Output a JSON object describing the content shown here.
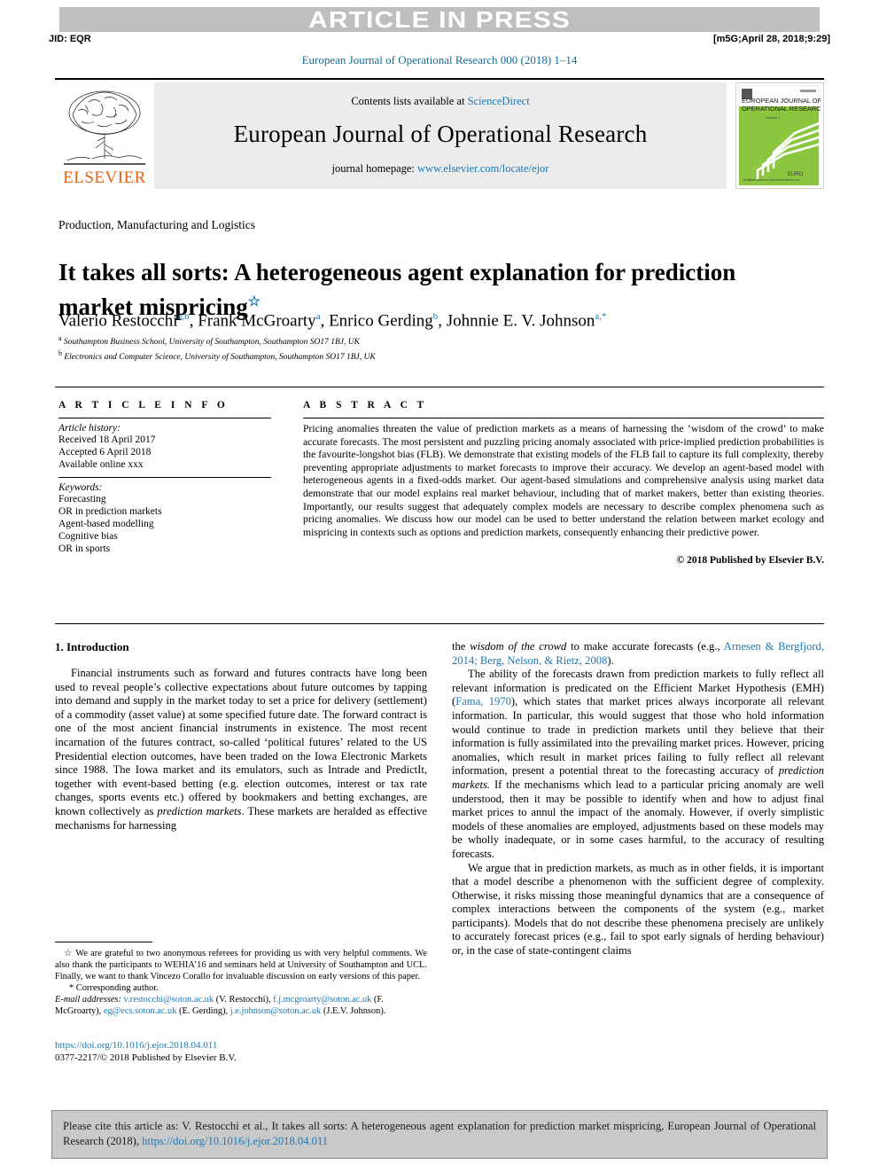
{
  "banner": {
    "text": "ARTICLE IN PRESS"
  },
  "runhead": {
    "left": "JID: EQR",
    "right": "[m5G;April 28, 2018;9:29]"
  },
  "journal_ref": "European Journal of Operational Research 000 (2018) 1–14",
  "masthead": {
    "contents_prefix": "Contents lists available at ",
    "contents_link": "ScienceDirect",
    "journal_title": "European Journal of Operational Research",
    "homepage_prefix": "journal homepage: ",
    "homepage_link": "www.elsevier.com/locate/ejor",
    "publisher": "ELSEVIER",
    "cover": {
      "line1": "EUROPEAN JOURNAL OF",
      "line2": "OPERATIONAL RESEARCH",
      "volume": "Volume 1",
      "footer": "EURO"
    }
  },
  "article": {
    "section_label": "Production, Manufacturing and Logistics",
    "title": "It takes all sorts: A heterogeneous agent explanation for prediction market mispricing",
    "title_mark": "☆",
    "authors_html": "Valerio Restocchi<sup>a,b</sup>, Frank McGroarty<sup>a</sup>, Enrico Gerding<sup>b</sup>, Johnnie E. V. Johnson<sup>a,*</sup>",
    "affiliations": [
      {
        "mark": "a",
        "text": "Southampton Business School, University of Southampton, Southampton SO17 1BJ, UK"
      },
      {
        "mark": "b",
        "text": "Electronics and Computer Science, University of Southampton, Southampton SO17 1BJ, UK"
      }
    ]
  },
  "info": {
    "heading": "A R T I C L E  I N F O",
    "history_label": "Article history:",
    "history": [
      "Received 18 April 2017",
      "Accepted 6 April 2018",
      "Available online xxx"
    ],
    "keywords_label": "Keywords:",
    "keywords": [
      "Forecasting",
      "OR in prediction markets",
      "Agent-based modelling",
      "Cognitive bias",
      "OR in sports"
    ]
  },
  "abstract": {
    "heading": "A B S T R A C T",
    "text": "Pricing anomalies threaten the value of prediction markets as a means of harnessing the ‘wisdom of the crowd’ to make accurate forecasts. The most persistent and puzzling pricing anomaly associated with price-implied prediction probabilities is the favourite-longshot bias (FLB). We demonstrate that existing models of the FLB fail to capture its full complexity, thereby preventing appropriate adjustments to market forecasts to improve their accuracy. We develop an agent-based model with heterogeneous agents in a fixed-odds market. Our agent-based simulations and comprehensive analysis using market data demonstrate that our model explains real market behaviour, including that of market makers, better than existing theories. Importantly, our results suggest that adequately complex models are necessary to describe complex phenomena such as pricing anomalies. We discuss how our model can be used to better understand the relation between market ecology and mispricing in contexts such as options and prediction markets, consequently enhancing their predictive power.",
    "copyright": "© 2018 Published by Elsevier B.V."
  },
  "body": {
    "section_number_title": "1. Introduction",
    "left_paragraphs": [
      "Financial instruments such as forward and futures contracts have long been used to reveal people’s collective expectations about future outcomes by tapping into demand and supply in the market today to set a price for delivery (settlement) of a commodity (asset value) at some specified future date. The forward contract is one of the most ancient financial instruments in existence. The most recent incarnation of the futures contract, so-called ‘political futures’ related to the US Presidential election outcomes, have been traded on the Iowa Electronic Markets since 1988. The Iowa market and its emulators, such as Intrade and PredictIt, together with event-based betting (e.g. election outcomes, interest or tax rate changes, sports events etc.) offered by bookmakers and betting exchanges, are known collectively as prediction markets. These markets are heralded as effective mechanisms for harnessing"
    ],
    "right_paragraphs": [
      "the wisdom of the crowd to make accurate forecasts (e.g., Arnesen & Bergfjord, 2014; Berg, Nelson, & Rietz, 2008).",
      "The ability of the forecasts drawn from prediction markets to fully reflect all relevant information is predicated on the Efficient Market Hypothesis (EMH) (Fama, 1970), which states that market prices always incorporate all relevant information. In particular, this would suggest that those who hold information would continue to trade in prediction markets until they believe that their information is fully assimilated into the prevailing market prices. However, pricing anomalies, which result in market prices failing to fully reflect all relevant information, present a potential threat to the forecasting accuracy of prediction markets. If the mechanisms which lead to a particular pricing anomaly are well understood, then it may be possible to identify when and how to adjust final market prices to annul the impact of the anomaly. However, if overly simplistic models of these anomalies are employed, adjustments based on these models may be wholly inadequate, or in some cases harmful, to the accuracy of resulting forecasts.",
      "We argue that in prediction markets, as much as in other fields, it is important that a model describe a phenomenon with the sufficient degree of complexity. Otherwise, it risks missing those meaningful dynamics that are a consequence of complex interactions between the components of the system (e.g., market participants). Models that do not describe these phenomena precisely are unlikely to accurately forecast prices (e.g., fail to spot early signals of herding behaviour) or, in the case of state-contingent claims"
    ]
  },
  "footnotes": {
    "acknowledgement": "☆ We are grateful to two anonymous referees for providing us with very helpful comments. We also thank the participants to WEHIA’16 and seminars held at University of Southampton and UCL. Finally, we want to thank Vincezo Corallo for invaluable discussion on early versions of this paper.",
    "corresponding": "* Corresponding author.",
    "email_label": "E-mail addresses:",
    "emails": [
      {
        "address": "v.restocchi@soton.ac.uk",
        "name": "(V. Restocchi),"
      },
      {
        "address": "f.j.mcgroarty@soton.ac.uk",
        "name": "(F. McGroarty),"
      },
      {
        "address": "eg@ecs.soton.ac.uk",
        "name": "(E. Gerding),"
      },
      {
        "address": "j.e.johnson@soton.ac.uk",
        "name": "(J.E.V. Johnson)."
      }
    ],
    "doi": "https://doi.org/10.1016/j.ejor.2018.04.011",
    "issn_line": "0377-2217/© 2018 Published by Elsevier B.V."
  },
  "citation_box": {
    "prefix": "Please cite this article as: V. Restocchi et al., It takes all sorts: A heterogeneous agent explanation for prediction market mispricing, European Journal of Operational Research (2018), ",
    "link": "https://doi.org/10.1016/j.ejor.2018.04.011"
  },
  "colors": {
    "link_blue": "#1b79b5",
    "elsevier_orange": "#e8620c",
    "banner_grey": "#bfbfbf",
    "cite_box_grey": "#c9c9c9",
    "masthead_grey": "#ececec",
    "cover_green": "#8cc63f"
  }
}
